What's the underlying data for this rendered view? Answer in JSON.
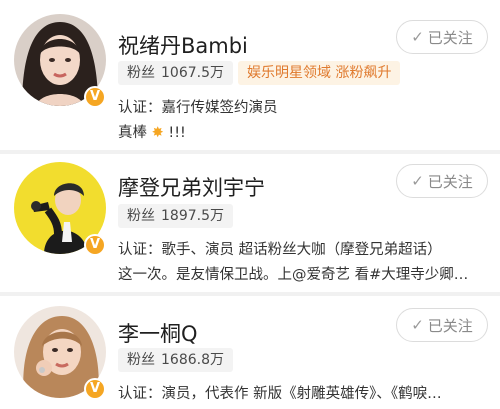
{
  "users": [
    {
      "name": "祝绪丹Bambi",
      "follow_label": "已关注",
      "fans_label": "粉丝",
      "fans_count": "1067.5万",
      "tag": "娱乐明星领域 涨粉飙升",
      "verify": "认证：嘉行传媒签约演员",
      "bio": "真棒",
      "bio_suffix": "!!!",
      "badge": "V"
    },
    {
      "name": "摩登兄弟刘宇宁",
      "follow_label": "已关注",
      "fans_label": "粉丝",
      "fans_count": "1897.5万",
      "verify": "认证：歌手、演员 超话粉丝大咖（摩登兄弟超话）",
      "bio": "这一次。是友情保卫战。上@爱奇艺 看#大理寺少卿…",
      "badge": "V"
    },
    {
      "name": "李一桐Q",
      "follow_label": "已关注",
      "fans_label": "粉丝",
      "fans_count": "1686.8万",
      "verify": "认证：演员，代表作 新版《射雕英雄传》、《鹤唳…",
      "badge": "V"
    }
  ],
  "icons": {
    "check": "check-icon",
    "spark": "sparkle-emoji-icon",
    "verified": "verified-badge-icon"
  },
  "colors": {
    "badge": "#f5a623",
    "tag_text": "#e07a2e",
    "tag_bg": "#fdf3e4"
  }
}
